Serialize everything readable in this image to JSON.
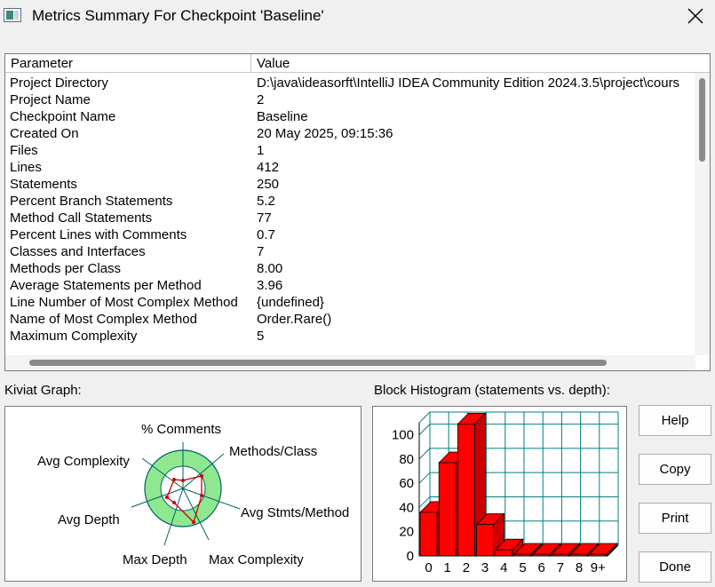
{
  "window": {
    "title": "Metrics Summary For Checkpoint 'Baseline'"
  },
  "table": {
    "headers": {
      "parameter": "Parameter",
      "value": "Value"
    },
    "rows": [
      {
        "param": "Project Directory",
        "value": "D:\\java\\ideasorft\\IntelliJ IDEA Community Edition 2024.3.5\\project\\cours"
      },
      {
        "param": "Project Name",
        "value": "2"
      },
      {
        "param": "Checkpoint Name",
        "value": "Baseline"
      },
      {
        "param": "Created On",
        "value": "20 May 2025, 09:15:36"
      },
      {
        "param": "Files",
        "value": "1"
      },
      {
        "param": "Lines",
        "value": "412"
      },
      {
        "param": "Statements",
        "value": "250"
      },
      {
        "param": "Percent Branch Statements",
        "value": "5.2"
      },
      {
        "param": "Method Call Statements",
        "value": "77"
      },
      {
        "param": "Percent Lines with Comments",
        "value": "0.7"
      },
      {
        "param": "Classes and Interfaces",
        "value": "7"
      },
      {
        "param": "Methods per Class",
        "value": "8.00"
      },
      {
        "param": "Average Statements per Method",
        "value": "3.96"
      },
      {
        "param": "Line Number of Most Complex Method",
        "value": "{undefined}"
      },
      {
        "param": "Name of Most Complex Method",
        "value": "Order.Rare()"
      },
      {
        "param": "Maximum Complexity",
        "value": "5"
      }
    ]
  },
  "kiviat": {
    "label": "Kiviat Graph:",
    "axes": {
      "comments": "% Comments",
      "methods_class": "Methods/Class",
      "avg_stmts": "Avg Stmts/Method",
      "max_complexity": "Max Complexity",
      "max_depth": "Max Depth",
      "avg_depth": "Avg Depth",
      "avg_complexity": "Avg Complexity"
    },
    "colors": {
      "outer_ring": "#8fe88f",
      "inner_ring": "#ffffff",
      "axis": "#006060",
      "polygon": "#cc0000"
    }
  },
  "histogram": {
    "label": "Block Histogram (statements vs. depth):",
    "bar_color": "#ff0000",
    "grid_color": "#008080"
  },
  "chart_data": {
    "type": "bar",
    "title": "Block Histogram (statements vs. depth):",
    "categories": [
      "0",
      "1",
      "2",
      "3",
      "4",
      "5",
      "6",
      "7",
      "8",
      "9+"
    ],
    "values": [
      36,
      77,
      109,
      26,
      5,
      1,
      1,
      1,
      1,
      1
    ],
    "ylim": [
      0,
      110
    ],
    "yticks": [
      "0",
      "20",
      "40",
      "60",
      "80",
      "100"
    ],
    "grid": true
  },
  "buttons": {
    "help": "Help",
    "copy": "Copy",
    "print": "Print",
    "done": "Done"
  }
}
